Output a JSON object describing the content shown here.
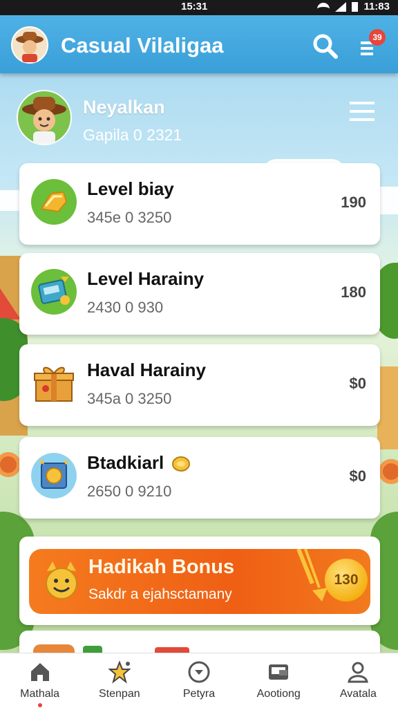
{
  "status_bar": {
    "time": "15:31",
    "battery": "11:83"
  },
  "app_bar": {
    "title": "Casual Vilaligaa",
    "menu_badge": "39"
  },
  "profile": {
    "name": "Neyalkan",
    "subtitle": "Gapila 0 2321"
  },
  "cards": [
    {
      "title": "Level biay",
      "subtitle": "345e 0 3250",
      "value": "190",
      "icon": "golden-trophy-icon"
    },
    {
      "title": "Level Harainy",
      "subtitle": "2430 0 930",
      "value": "180",
      "icon": "cash-register-icon"
    },
    {
      "title": "Haval Harainy",
      "subtitle": "345a 0 3250",
      "value": "$0",
      "icon": "gift-box-icon"
    },
    {
      "title": "Btadkiarl",
      "subtitle": "2650 0 9210",
      "value": "$0",
      "icon": "coin-frame-icon"
    }
  ],
  "bonus": {
    "title": "Hadikah Bonus",
    "subtitle": "Sakdr a ejahsctamany",
    "coin_value": "130",
    "icon": "devil-mascot-icon"
  },
  "bottom_nav": [
    {
      "label": "Mathala",
      "icon": "home-icon",
      "active": true
    },
    {
      "label": "Stenpan",
      "icon": "star-icon",
      "active": false
    },
    {
      "label": "Petyra",
      "icon": "download-circle-icon",
      "active": false
    },
    {
      "label": "Aootiong",
      "icon": "wallet-icon",
      "active": false
    },
    {
      "label": "Avatala",
      "icon": "user-icon",
      "active": false
    }
  ],
  "colors": {
    "app_bar": "#3a9fd8",
    "bonus": "#f06a18",
    "badge": "#e8453c",
    "coin": "#f5b214"
  }
}
